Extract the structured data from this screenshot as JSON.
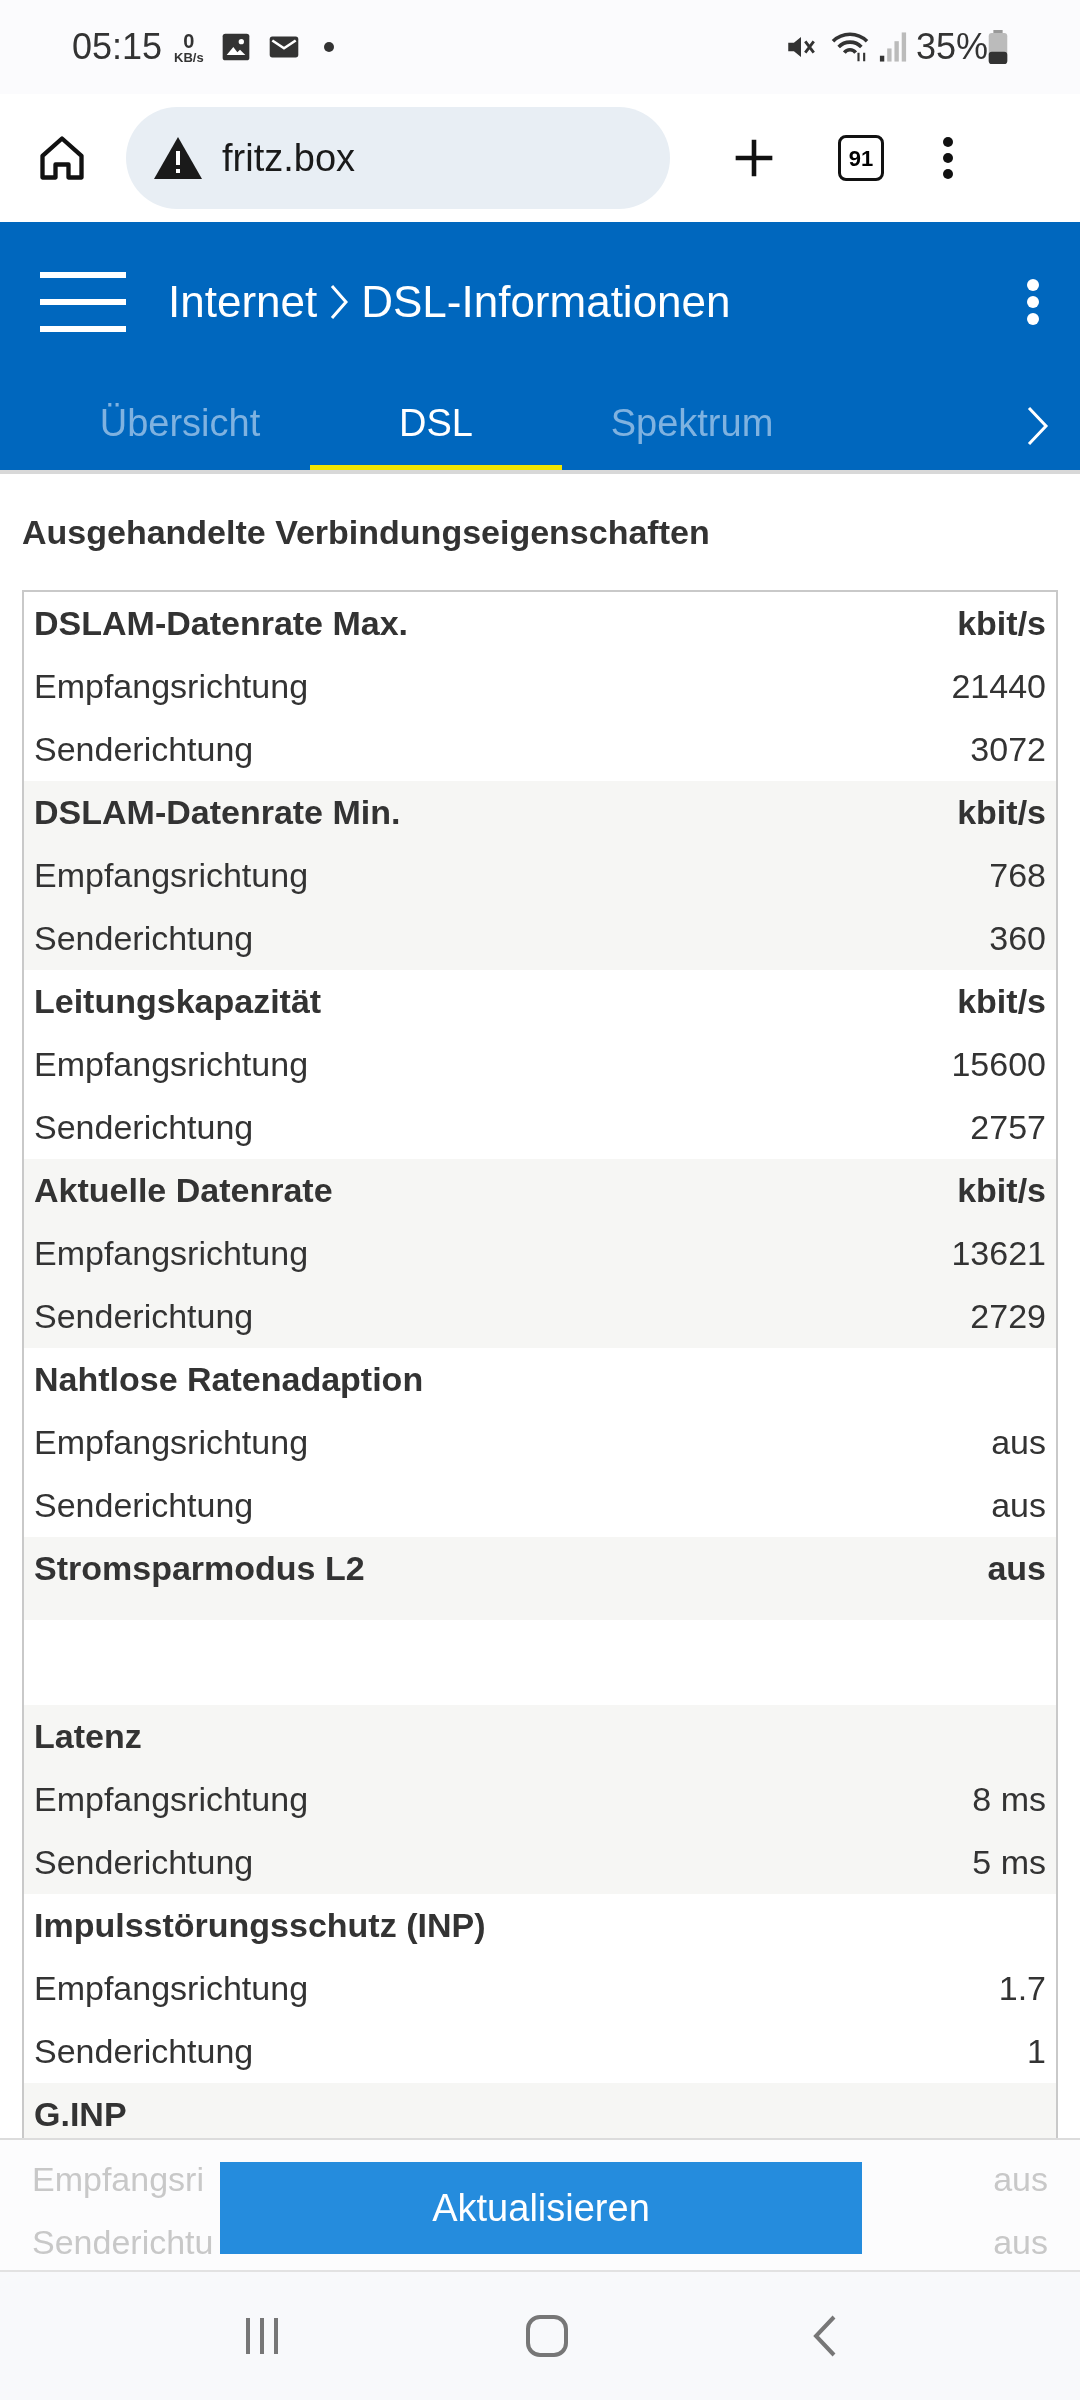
{
  "status_bar": {
    "time": "05:15",
    "speed_value": "0",
    "speed_unit": "KB/s",
    "battery": "35%"
  },
  "browser": {
    "url": "fritz.box",
    "tab_count": "91"
  },
  "app_bar": {
    "section": "Internet",
    "page": "DSL-Informationen"
  },
  "tabs": [
    {
      "label": "Übersicht",
      "selected": false
    },
    {
      "label": "DSL",
      "selected": true
    },
    {
      "label": "Spektrum",
      "selected": false
    }
  ],
  "heading": "Ausgehandelte Verbindungseigenschaften",
  "groups": [
    {
      "label": "DSLAM-Datenrate Max.",
      "unit": "kbit/s",
      "rows": [
        {
          "label": "Empfangsrichtung",
          "value": "21440"
        },
        {
          "label": "Senderichtung",
          "value": "3072"
        }
      ]
    },
    {
      "label": "DSLAM-Datenrate Min.",
      "unit": "kbit/s",
      "rows": [
        {
          "label": "Empfangsrichtung",
          "value": "768"
        },
        {
          "label": "Senderichtung",
          "value": "360"
        }
      ]
    },
    {
      "label": "Leitungskapazität",
      "unit": "kbit/s",
      "rows": [
        {
          "label": "Empfangsrichtung",
          "value": "15600"
        },
        {
          "label": "Senderichtung",
          "value": "2757"
        }
      ]
    },
    {
      "label": "Aktuelle Datenrate",
      "unit": "kbit/s",
      "rows": [
        {
          "label": "Empfangsrichtung",
          "value": "13621"
        },
        {
          "label": "Senderichtung",
          "value": "2729"
        }
      ]
    },
    {
      "label": "Nahtlose Ratenadaption",
      "rows": [
        {
          "label": "Empfangsrichtung",
          "value": "aus"
        },
        {
          "label": "Senderichtung",
          "value": "aus"
        }
      ]
    },
    {
      "label": "Stromsparmodus L2",
      "unit": "aus"
    },
    {
      "label": "Latenz",
      "rows": [
        {
          "label": "Empfangsrichtung",
          "value": "8 ms"
        },
        {
          "label": "Senderichtung",
          "value": "5 ms"
        }
      ]
    },
    {
      "label": "Impulsstörungsschutz (INP)",
      "rows": [
        {
          "label": "Empfangsrichtung",
          "value": "1.7"
        },
        {
          "label": "Senderichtung",
          "value": "1"
        }
      ]
    },
    {
      "label": "G.INP"
    }
  ],
  "faded_rows": [
    {
      "label": "Empfangsri",
      "value": "aus"
    },
    {
      "label": "Senderichtu",
      "value": "aus"
    }
  ],
  "button": "Aktualisieren"
}
